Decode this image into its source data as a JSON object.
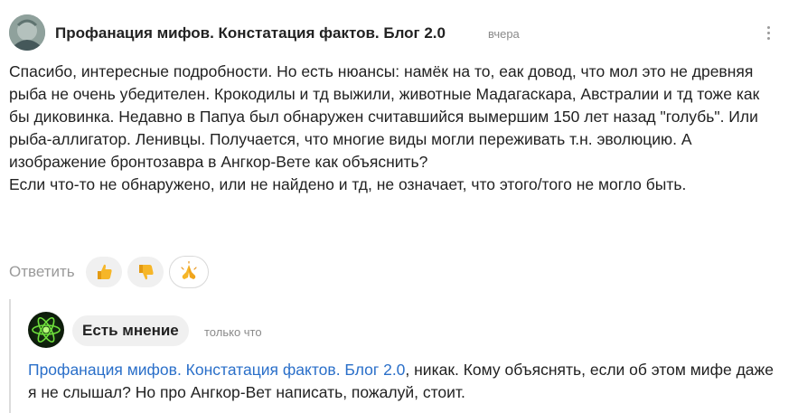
{
  "comment": {
    "author": "Профанация мифов. Констатация фактов. Блог 2.0",
    "time": "вчера",
    "paragraphs": [
      "Спасибо, интересные подробности. Но есть нюансы: намёк на то, еак довод, что мол это не древняя рыба не очень убедителен. Крокодилы и тд выжили, животные Мадагаскара, Австралии и тд тоже как бы диковинка. Недавно в Папуа был обнаружен считавшийся вымершим 150 лет назад \"голубь\". Или рыба-аллигатор. Ленивцы. Получается, что многие виды могли переживать т.н. эволюцию. А изображение бронтозавра в Ангкор-Вете как объяснить?",
      "Если что-то не обнаружено, или не найдено и тд, не означает, что этого/того не могло быть."
    ],
    "reply_label": "Ответить",
    "reactions": [
      {
        "icon": "thumbs-up-icon"
      },
      {
        "icon": "thumbs-down-icon"
      },
      {
        "icon": "praying-hands-icon"
      }
    ]
  },
  "reply": {
    "author": "Есть мнение",
    "time": "только что",
    "mention": "Профанация мифов. Констатация фактов. Блог 2.0",
    "text": ", никак. Кому объяснять, если об этом мифе даже я не слышал? Но про Ангкор-Вет написать, пожалуй, стоит."
  },
  "colors": {
    "mention": "#2a6fc9",
    "muted_text": "#8a8a8a",
    "chip_background": "#f0f0f0",
    "emoji_yellow": "#f6b628"
  }
}
